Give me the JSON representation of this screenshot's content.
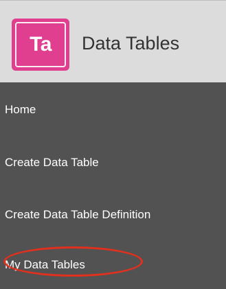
{
  "header": {
    "logo_text": "Ta",
    "app_title": "Data Tables"
  },
  "nav": {
    "items": [
      {
        "label": "Home"
      },
      {
        "label": "Create Data Table"
      },
      {
        "label": "Create Data Table Definition"
      },
      {
        "label": "My Data Tables"
      }
    ]
  },
  "colors": {
    "header_bg": "#dcdcdc",
    "logo_bg": "#df3f8e",
    "nav_bg": "#525252",
    "highlight": "#e0301e"
  }
}
